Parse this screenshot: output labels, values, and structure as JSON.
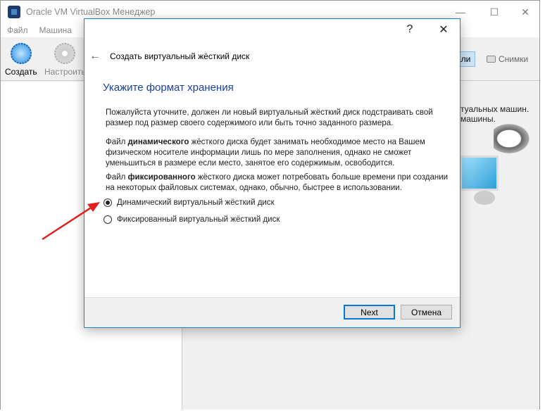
{
  "window": {
    "title": "Oracle VM VirtualBox Менеджер",
    "minimize": "—",
    "maximize": "☐",
    "close": "✕"
  },
  "menu": [
    "Файл",
    "Машина"
  ],
  "toolbar": {
    "create": "Создать",
    "settings": "Настроить"
  },
  "tabs": {
    "details_partial": "али",
    "snapshots": "Снимки"
  },
  "welcome": {
    "line1": "туальных машин.",
    "line2": "машины."
  },
  "dialog": {
    "help": "?",
    "close": "✕",
    "title": "Создать виртуальный жёсткий диск",
    "heading": "Укажите формат хранения",
    "para1": "Пожалуйста уточните, должен ли новый виртуальный жёсткий диск подстраивать свой размер под размер своего содержимого или быть точно заданного размера.",
    "para2_pre": "Файл ",
    "para2_bold": "динамического",
    "para2_post": " жёсткого диска будет занимать необходимое место на Вашем физическом носителе информации лишь по мере заполнения, однако не сможет уменьшиться в размере если место, занятое его содержимым, освободится.",
    "para3_pre": "Файл ",
    "para3_bold": "фиксированного",
    "para3_post": " жёсткого диска может потребовать больше времени при создании на некоторых файловых системах, однако, обычно, быстрее в использовании.",
    "options": [
      {
        "label": "Динамический виртуальный жёсткий диск",
        "selected": true
      },
      {
        "label": "Фиксированный виртуальный жёсткий диск",
        "selected": false
      }
    ],
    "next": "Next",
    "cancel": "Отмена"
  },
  "colors": {
    "accent": "#0078d7",
    "heading": "#1a3fa0",
    "annotation_arrow": "#e02020"
  }
}
